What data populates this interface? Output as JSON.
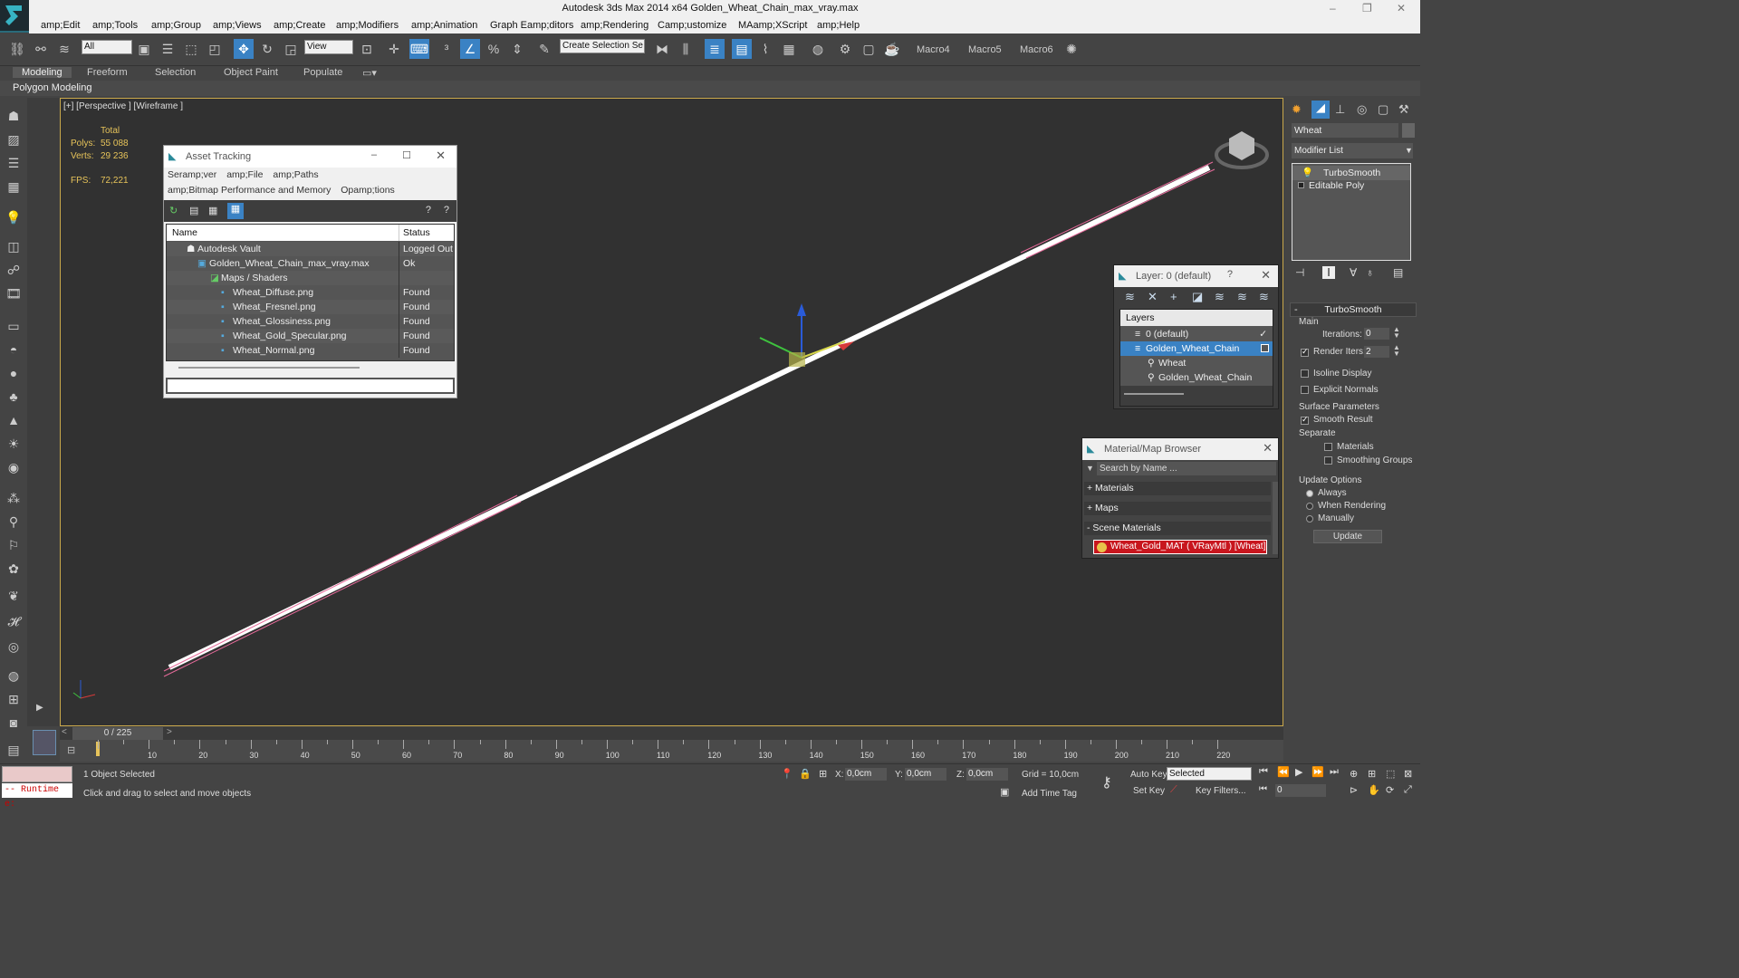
{
  "window": {
    "title": "Autodesk 3ds Max  2014 x64     Golden_Wheat_Chain_max_vray.max",
    "controls": [
      "–",
      "❐",
      "✕"
    ]
  },
  "menu": [
    "amp;Edit",
    "amp;Tools",
    "amp;Group",
    "amp;Views",
    "amp;Create",
    "amp;Modifiers",
    "amp;Animation",
    "Graph Eamp;ditors",
    "amp;Rendering",
    "Camp;ustomize",
    "MAamp;XScript",
    "amp;Help"
  ],
  "toolbar": {
    "filter": "All",
    "refcoord": "View",
    "named_sel": "Create Selection Se",
    "macros": [
      "Macro4",
      "Macro5",
      "Macro6"
    ]
  },
  "ribbon": {
    "tabs": [
      "Modeling",
      "Freeform",
      "Selection",
      "Object Paint",
      "Populate"
    ],
    "sub": "Polygon Modeling"
  },
  "viewport": {
    "label": "[+] [Perspective ] [Wireframe ]",
    "stats": {
      "total": "Total",
      "polys_label": "Polys:",
      "polys": "55 088",
      "verts_label": "Verts:",
      "verts": "29 236",
      "fps_label": "FPS:",
      "fps": "72,221"
    }
  },
  "asset_tracking": {
    "title": "Asset Tracking",
    "menu": [
      "Seramp;ver",
      "amp;File",
      "amp;Paths",
      "amp;Bitmap Performance and Memory",
      "Opamp;tions"
    ],
    "columns": [
      "Name",
      "Status"
    ],
    "rows": [
      {
        "name": "Autodesk Vault",
        "status": "Logged Out ..."
      },
      {
        "name": "Golden_Wheat_Chain_max_vray.max",
        "status": "Ok"
      },
      {
        "name": "Maps / Shaders",
        "status": ""
      },
      {
        "name": "Wheat_Diffuse.png",
        "status": "Found"
      },
      {
        "name": "Wheat_Fresnel.png",
        "status": "Found"
      },
      {
        "name": "Wheat_Glossiness.png",
        "status": "Found"
      },
      {
        "name": "Wheat_Gold_Specular.png",
        "status": "Found"
      },
      {
        "name": "Wheat_Normal.png",
        "status": "Found"
      }
    ]
  },
  "layers": {
    "title": "Layer: 0 (default)",
    "header": "Layers",
    "items": [
      "0 (default)",
      "Golden_Wheat_Chain",
      "Wheat",
      "Golden_Wheat_Chain"
    ]
  },
  "material_browser": {
    "title": "Material/Map Browser",
    "search_placeholder": "Search by Name ...",
    "groups": [
      "+ Materials",
      "+ Maps",
      "- Scene Materials"
    ],
    "scene_material": "Wheat_Gold_MAT ( VRayMtl ) [Wheat]"
  },
  "command_panel": {
    "object_name": "Wheat",
    "modifier_list": "Modifier List",
    "stack": [
      "TurboSmooth",
      "Editable Poly"
    ],
    "rollout": "TurboSmooth",
    "main": "Main",
    "iterations_label": "Iterations:",
    "iterations": "0",
    "render_iters_label": "Render Iters:",
    "render_iters": "2",
    "isoline": "Isoline Display",
    "explicit": "Explicit Normals",
    "surface": "Surface Parameters",
    "smooth_result": "Smooth Result",
    "separate": "Separate",
    "materials": "Materials",
    "smoothing_groups": "Smoothing Groups",
    "update_options": "Update Options",
    "always": "Always",
    "when_rendering": "When Rendering",
    "manually": "Manually",
    "update_btn": "Update"
  },
  "timeline": {
    "frame": "0 / 225",
    "ticks": [
      "10",
      "20",
      "30",
      "40",
      "50",
      "60",
      "70",
      "80",
      "90",
      "100",
      "110",
      "120",
      "130",
      "140",
      "150",
      "160",
      "170",
      "180",
      "190",
      "200",
      "210",
      "220"
    ]
  },
  "status": {
    "script": "-- Runtime e:",
    "selected": "1 Object Selected",
    "prompt": "Click and drag to select and move objects",
    "x_label": "X:",
    "x": "0,0cm",
    "y_label": "Y:",
    "y": "0,0cm",
    "z_label": "Z:",
    "z": "0,0cm",
    "grid": "Grid = 10,0cm",
    "add_time_tag": "Add Time Tag",
    "auto_key": "Auto Key",
    "set_key": "Set Key",
    "selected_dd": "Selected",
    "key_filters": "Key Filters...",
    "frame_field": "0"
  }
}
